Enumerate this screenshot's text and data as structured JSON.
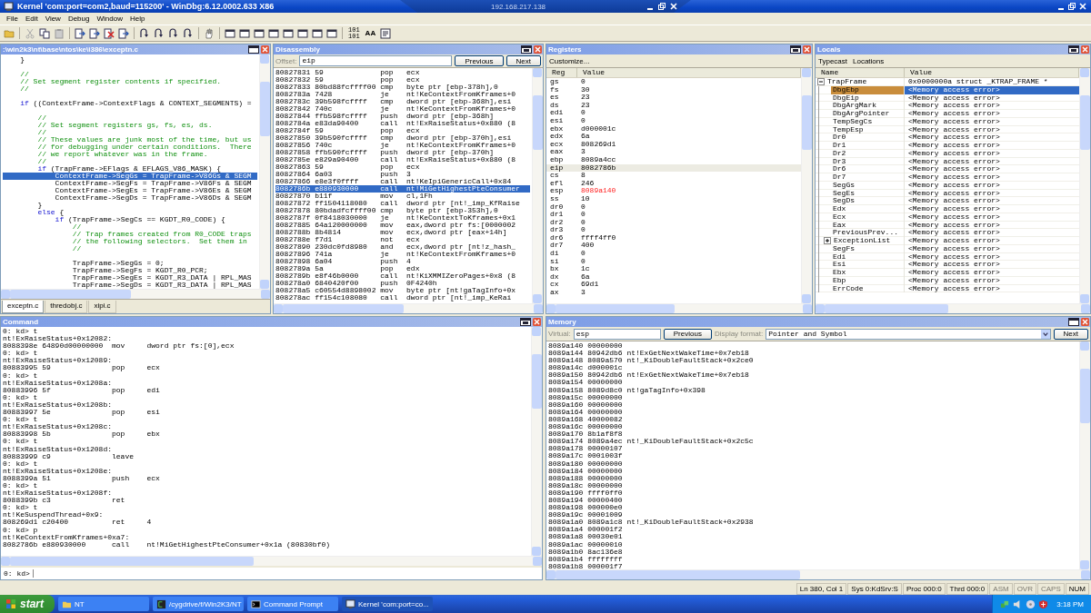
{
  "window": {
    "title": "Kernel 'com:port=com2,baud=115200' - WinDbg:6.12.0002.633 X86"
  },
  "remote_bar": {
    "host": "192.168.217.138"
  },
  "menu": [
    "File",
    "Edit",
    "View",
    "Debug",
    "Window",
    "Help"
  ],
  "toolbar": {
    "binary_labels": [
      "101",
      "101"
    ],
    "font_label": "AA"
  },
  "source": {
    "title": ":\\win2k3\\nt\\base\\ntos\\ke\\i386\\exceptn.c",
    "lines": [
      {
        "kind": "text",
        "selected": false,
        "segs": [
          {
            "kind": "code",
            "text": "    }"
          }
        ]
      },
      {
        "kind": "blank",
        "selected": false
      },
      {
        "kind": "text",
        "selected": false,
        "segs": [
          {
            "kind": "comment",
            "text": "    //"
          }
        ]
      },
      {
        "kind": "text",
        "selected": false,
        "segs": [
          {
            "kind": "comment",
            "text": "    // Set segment register contents if specified."
          }
        ]
      },
      {
        "kind": "text",
        "selected": false,
        "segs": [
          {
            "kind": "comment",
            "text": "    //"
          }
        ]
      },
      {
        "kind": "blank",
        "selected": false
      },
      {
        "kind": "text",
        "selected": false,
        "segs": [
          {
            "kind": "keyword",
            "text": "    if"
          },
          {
            "kind": "code",
            "text": " ((ContextFrame->ContextFlags & CONTEXT_SEGMENTS) ="
          }
        ]
      },
      {
        "kind": "blank",
        "selected": false
      },
      {
        "kind": "text",
        "selected": false,
        "segs": [
          {
            "kind": "comment",
            "text": "        //"
          }
        ]
      },
      {
        "kind": "text",
        "selected": false,
        "segs": [
          {
            "kind": "comment",
            "text": "        // Set segment registers gs, fs, es, ds."
          }
        ]
      },
      {
        "kind": "text",
        "selected": false,
        "segs": [
          {
            "kind": "comment",
            "text": "        //"
          }
        ]
      },
      {
        "kind": "text",
        "selected": false,
        "segs": [
          {
            "kind": "comment",
            "text": "        // These values are junk most of the time, but us"
          }
        ]
      },
      {
        "kind": "text",
        "selected": false,
        "segs": [
          {
            "kind": "comment",
            "text": "        // for debugging under certain conditions.  There"
          }
        ]
      },
      {
        "kind": "text",
        "selected": false,
        "segs": [
          {
            "kind": "comment",
            "text": "        // we report whatever was in the frame."
          }
        ]
      },
      {
        "kind": "text",
        "selected": false,
        "segs": [
          {
            "kind": "comment",
            "text": "        //"
          }
        ]
      },
      {
        "kind": "text",
        "selected": false,
        "segs": [
          {
            "kind": "keyword",
            "text": "        if"
          },
          {
            "kind": "code",
            "text": " (TrapFrame->EFlags & EFLAGS_V86_MASK) {"
          }
        ]
      },
      {
        "kind": "text",
        "selected": true,
        "segs": [
          {
            "kind": "code",
            "text": "            ContextFrame->SegGs = TrapFrame->V86Gs & SEGM"
          }
        ]
      },
      {
        "kind": "text",
        "selected": false,
        "segs": [
          {
            "kind": "code",
            "text": "            ContextFrame->SegFs = TrapFrame->V86Fs & SEGM"
          }
        ]
      },
      {
        "kind": "text",
        "selected": false,
        "segs": [
          {
            "kind": "code",
            "text": "            ContextFrame->SegEs = TrapFrame->V86Es & SEGM"
          }
        ]
      },
      {
        "kind": "text",
        "selected": false,
        "segs": [
          {
            "kind": "code",
            "text": "            ContextFrame->SegDs = TrapFrame->V86Ds & SEGM"
          }
        ]
      },
      {
        "kind": "text",
        "selected": false,
        "segs": [
          {
            "kind": "code",
            "text": "        }"
          }
        ]
      },
      {
        "kind": "text",
        "selected": false,
        "segs": [
          {
            "kind": "keyword",
            "text": "        else"
          },
          {
            "kind": "code",
            "text": " {"
          }
        ]
      },
      {
        "kind": "text",
        "selected": false,
        "segs": [
          {
            "kind": "keyword",
            "text": "            if"
          },
          {
            "kind": "code",
            "text": " (TrapFrame->SegCs == KGDT_R0_CODE) {"
          }
        ]
      },
      {
        "kind": "text",
        "selected": false,
        "segs": [
          {
            "kind": "comment",
            "text": "                //"
          }
        ]
      },
      {
        "kind": "text",
        "selected": false,
        "segs": [
          {
            "kind": "comment",
            "text": "                // Trap frames created from R0_CODE traps"
          }
        ]
      },
      {
        "kind": "text",
        "selected": false,
        "segs": [
          {
            "kind": "comment",
            "text": "                // the following selectors.  Set them in"
          }
        ]
      },
      {
        "kind": "text",
        "selected": false,
        "segs": [
          {
            "kind": "comment",
            "text": "                //"
          }
        ]
      },
      {
        "kind": "blank",
        "selected": false
      },
      {
        "kind": "text",
        "selected": false,
        "segs": [
          {
            "kind": "code",
            "text": "                TrapFrame->SegGs = 0;"
          }
        ]
      },
      {
        "kind": "text",
        "selected": false,
        "segs": [
          {
            "kind": "code",
            "text": "                TrapFrame->SegFs = KGDT_R0_PCR;"
          }
        ]
      },
      {
        "kind": "text",
        "selected": false,
        "segs": [
          {
            "kind": "code",
            "text": "                TrapFrame->SegEs = KGDT_R3_DATA | RPL_MAS"
          }
        ]
      },
      {
        "kind": "text",
        "selected": false,
        "segs": [
          {
            "kind": "code",
            "text": "                TrapFrame->SegDs = KGDT_R3_DATA | RPL_MAS"
          }
        ]
      }
    ],
    "tabs": [
      {
        "label": "exceptn.c",
        "selected": true
      },
      {
        "label": "thredobj.c",
        "selected": false
      },
      {
        "label": "xipi.c",
        "selected": false
      }
    ]
  },
  "disassembly": {
    "title": "Disassembly",
    "offset_label": "Offset:",
    "offset": "eip",
    "previous": "Previous",
    "next": "Next",
    "rows": [
      {
        "address": "80827831",
        "bytes": "59",
        "op": "pop",
        "args": "ecx",
        "selected": false
      },
      {
        "address": "80827832",
        "bytes": "59",
        "op": "pop",
        "args": "ecx",
        "selected": false
      },
      {
        "address": "80827833",
        "bytes": "80bd88fcffff00",
        "op": "cmp",
        "args": "byte ptr [ebp-378h],0",
        "selected": false
      },
      {
        "address": "8082783a",
        "bytes": "7428",
        "op": "je",
        "args": "nt!KeContextFromKframes+0",
        "selected": false
      },
      {
        "address": "8082783c",
        "bytes": "39b598fcffff",
        "op": "cmp",
        "args": "dword ptr [ebp-368h],esi",
        "selected": false
      },
      {
        "address": "80827842",
        "bytes": "740c",
        "op": "je",
        "args": "nt!KeContextFromKframes+0",
        "selected": false
      },
      {
        "address": "80827844",
        "bytes": "ffb598fcffff",
        "op": "push",
        "args": "dword ptr [ebp-368h]",
        "selected": false
      },
      {
        "address": "8082784a",
        "bytes": "e83da90400",
        "op": "call",
        "args": "nt!ExRaiseStatus+0x880 (8",
        "selected": false
      },
      {
        "address": "8082784f",
        "bytes": "59",
        "op": "pop",
        "args": "ecx",
        "selected": false
      },
      {
        "address": "80827850",
        "bytes": "39b590fcffff",
        "op": "cmp",
        "args": "dword ptr [ebp-370h],esi",
        "selected": false
      },
      {
        "address": "80827856",
        "bytes": "740c",
        "op": "je",
        "args": "nt!KeContextFromKframes+0",
        "selected": false
      },
      {
        "address": "80827858",
        "bytes": "ffb590fcffff",
        "op": "push",
        "args": "dword ptr [ebp-370h]",
        "selected": false
      },
      {
        "address": "8082785e",
        "bytes": "e829a90400",
        "op": "call",
        "args": "nt!ExRaiseStatus+0x880 (8",
        "selected": false
      },
      {
        "address": "80827863",
        "bytes": "59",
        "op": "pop",
        "args": "ecx",
        "selected": false
      },
      {
        "address": "80827864",
        "bytes": "6a03",
        "op": "push",
        "args": "3",
        "selected": false
      },
      {
        "address": "80827866",
        "bytes": "e8e3f0ffff",
        "op": "call",
        "args": "nt!KeIpiGenericCall+0x84",
        "selected": false
      },
      {
        "address": "8082786b",
        "bytes": "e880930000",
        "op": "call",
        "args": "nt!MiGetHighestPteConsumer",
        "selected": true
      },
      {
        "address": "80827870",
        "bytes": "b11f",
        "op": "mov",
        "args": "cl,1Fh",
        "selected": false
      },
      {
        "address": "80827872",
        "bytes": "ff1504118080",
        "op": "call",
        "args": "dword ptr [nt!_imp_KfRaise",
        "selected": false
      },
      {
        "address": "80827878",
        "bytes": "80bdadfcffff00",
        "op": "cmp",
        "args": "byte ptr [ebp-353h],0",
        "selected": false
      },
      {
        "address": "8082787f",
        "bytes": "0f8418030000",
        "op": "je",
        "args": "nt!KeContextToKframes+0x1",
        "selected": false
      },
      {
        "address": "80827885",
        "bytes": "64a120000000",
        "op": "mov",
        "args": "eax,dword ptr fs:[0000002",
        "selected": false
      },
      {
        "address": "8082788b",
        "bytes": "8b4814",
        "op": "mov",
        "args": "ecx,dword ptr [eax+14h]",
        "selected": false
      },
      {
        "address": "8082788e",
        "bytes": "f7d1",
        "op": "not",
        "args": "ecx",
        "selected": false
      },
      {
        "address": "80827890",
        "bytes": "230dc0fd8980",
        "op": "and",
        "args": "ecx,dword ptr [nt!z_hash_",
        "selected": false
      },
      {
        "address": "80827896",
        "bytes": "741a",
        "op": "je",
        "args": "nt!KeContextFromKframes+0",
        "selected": false
      },
      {
        "address": "80827898",
        "bytes": "6a04",
        "op": "push",
        "args": "4",
        "selected": false
      },
      {
        "address": "8082789a",
        "bytes": "5a",
        "op": "pop",
        "args": "edx",
        "selected": false
      },
      {
        "address": "8082789b",
        "bytes": "e8f46b0000",
        "op": "call",
        "args": "nt!KiXMMIZeroPages+0x8 (8",
        "selected": false
      },
      {
        "address": "808278a0",
        "bytes": "6840420f00",
        "op": "push",
        "args": "0F4240h",
        "selected": false
      },
      {
        "address": "808278a5",
        "bytes": "c60554d8898002",
        "op": "mov",
        "args": "byte ptr [nt!gaTagInfo+0x",
        "selected": false
      },
      {
        "address": "808278ac",
        "bytes": "ff154c108080",
        "op": "call",
        "args": "dword ptr [nt!_imp_KeRai",
        "selected": false
      }
    ]
  },
  "registers": {
    "title": "Registers",
    "customize": "Customize...",
    "columns": [
      "Reg",
      "Value"
    ],
    "rows": [
      {
        "name": "gs",
        "value": "0",
        "selected": false,
        "changed": false
      },
      {
        "name": "fs",
        "value": "30",
        "selected": false,
        "changed": false
      },
      {
        "name": "es",
        "value": "23",
        "selected": false,
        "changed": false
      },
      {
        "name": "ds",
        "value": "23",
        "selected": false,
        "changed": false
      },
      {
        "name": "edi",
        "value": "0",
        "selected": false,
        "changed": false
      },
      {
        "name": "esi",
        "value": "0",
        "selected": false,
        "changed": false
      },
      {
        "name": "ebx",
        "value": "d000001c",
        "selected": false,
        "changed": false
      },
      {
        "name": "edx",
        "value": "6a",
        "selected": false,
        "changed": false
      },
      {
        "name": "ecx",
        "value": "808269d1",
        "selected": false,
        "changed": false
      },
      {
        "name": "eax",
        "value": "3",
        "selected": false,
        "changed": false
      },
      {
        "name": "ebp",
        "value": "8089a4cc",
        "selected": false,
        "changed": false
      },
      {
        "name": "eip",
        "value": "8082786b",
        "selected": true,
        "changed": false
      },
      {
        "name": "cs",
        "value": "8",
        "selected": false,
        "changed": false
      },
      {
        "name": "efl",
        "value": "246",
        "selected": false,
        "changed": false
      },
      {
        "name": "esp",
        "value": "8089a140",
        "selected": false,
        "changed": true
      },
      {
        "name": "ss",
        "value": "10",
        "selected": false,
        "changed": false
      },
      {
        "name": "dr0",
        "value": "0",
        "selected": false,
        "changed": false
      },
      {
        "name": "dr1",
        "value": "0",
        "selected": false,
        "changed": false
      },
      {
        "name": "dr2",
        "value": "0",
        "selected": false,
        "changed": false
      },
      {
        "name": "dr3",
        "value": "0",
        "selected": false,
        "changed": false
      },
      {
        "name": "dr6",
        "value": "ffff4ff0",
        "selected": false,
        "changed": false
      },
      {
        "name": "dr7",
        "value": "400",
        "selected": false,
        "changed": false
      },
      {
        "name": "di",
        "value": "0",
        "selected": false,
        "changed": false
      },
      {
        "name": "si",
        "value": "0",
        "selected": false,
        "changed": false
      },
      {
        "name": "bx",
        "value": "1c",
        "selected": false,
        "changed": false
      },
      {
        "name": "dx",
        "value": "6a",
        "selected": false,
        "changed": false
      },
      {
        "name": "cx",
        "value": "69d1",
        "selected": false,
        "changed": false
      },
      {
        "name": "ax",
        "value": "3",
        "selected": false,
        "changed": false
      }
    ]
  },
  "locals": {
    "title": "Locals",
    "menu": [
      "Typecast",
      "Locations"
    ],
    "columns": [
      "Name",
      "Value"
    ],
    "root": {
      "name": "TrapFrame",
      "value": "0x0000000a struct _KTRAP_FRAME *",
      "expanded": true,
      "children": [
        {
          "name": "DbgEbp",
          "value": "<Memory access error>",
          "kind": "field",
          "selected": true
        },
        {
          "name": "DbgEip",
          "value": "<Memory access error>",
          "kind": "field",
          "selected": false
        },
        {
          "name": "DbgArgMark",
          "value": "<Memory access error>",
          "kind": "field",
          "selected": false
        },
        {
          "name": "DbgArgPointer",
          "value": "<Memory access error>",
          "kind": "field",
          "selected": false
        },
        {
          "name": "TempSegCs",
          "value": "<Memory access error>",
          "kind": "field",
          "selected": false
        },
        {
          "name": "TempEsp",
          "value": "<Memory access error>",
          "kind": "field",
          "selected": false
        },
        {
          "name": "Dr0",
          "value": "<Memory access error>",
          "kind": "field",
          "selected": false
        },
        {
          "name": "Dr1",
          "value": "<Memory access error>",
          "kind": "field",
          "selected": false
        },
        {
          "name": "Dr2",
          "value": "<Memory access error>",
          "kind": "field",
          "selected": false
        },
        {
          "name": "Dr3",
          "value": "<Memory access error>",
          "kind": "field",
          "selected": false
        },
        {
          "name": "Dr6",
          "value": "<Memory access error>",
          "kind": "field",
          "selected": false
        },
        {
          "name": "Dr7",
          "value": "<Memory access error>",
          "kind": "field",
          "selected": false
        },
        {
          "name": "SegGs",
          "value": "<Memory access error>",
          "kind": "field",
          "selected": false
        },
        {
          "name": "SegEs",
          "value": "<Memory access error>",
          "kind": "field",
          "selected": false
        },
        {
          "name": "SegDs",
          "value": "<Memory access error>",
          "kind": "field",
          "selected": false
        },
        {
          "name": "Edx",
          "value": "<Memory access error>",
          "kind": "field",
          "selected": false
        },
        {
          "name": "Ecx",
          "value": "<Memory access error>",
          "kind": "field",
          "selected": false
        },
        {
          "name": "Eax",
          "value": "<Memory access error>",
          "kind": "field",
          "selected": false
        },
        {
          "name": "PreviousPrev...",
          "value": "<Memory access error>",
          "kind": "field",
          "selected": false
        },
        {
          "name": "ExceptionList",
          "value": "<Memory access error>",
          "kind": "struct",
          "expanded": false,
          "selected": false
        },
        {
          "name": "SegFs",
          "value": "<Memory access error>",
          "kind": "field",
          "selected": false
        },
        {
          "name": "Edi",
          "value": "<Memory access error>",
          "kind": "field",
          "selected": false
        },
        {
          "name": "Esi",
          "value": "<Memory access error>",
          "kind": "field",
          "selected": false
        },
        {
          "name": "Ebx",
          "value": "<Memory access error>",
          "kind": "field",
          "selected": false
        },
        {
          "name": "Ebp",
          "value": "<Memory access error>",
          "kind": "field",
          "selected": false
        },
        {
          "name": "ErrCode",
          "value": "<Memory access error>",
          "kind": "field",
          "selected": false
        }
      ]
    }
  },
  "command": {
    "title": "Command",
    "prompt": "0: kd>",
    "lines": [
      "0: kd> t",
      "nt!ExRaiseStatus+0x12082:",
      "8088398e 64890d00000000  mov     dword ptr fs:[0],ecx",
      "0: kd> t",
      "nt!ExRaiseStatus+0x12089:",
      "80883995 59              pop     ecx",
      "0: kd> t",
      "nt!ExRaiseStatus+0x1208a:",
      "80883996 5f              pop     edi",
      "0: kd> t",
      "nt!ExRaiseStatus+0x1208b:",
      "80883997 5e              pop     esi",
      "0: kd> t",
      "nt!ExRaiseStatus+0x1208c:",
      "80883998 5b              pop     ebx",
      "0: kd> t",
      "nt!ExRaiseStatus+0x1208d:",
      "80883999 c9              leave",
      "0: kd> t",
      "nt!ExRaiseStatus+0x1208e:",
      "8088399a 51              push    ecx",
      "0: kd> t",
      "nt!ExRaiseStatus+0x1208f:",
      "8088399b c3              ret",
      "0: kd> t",
      "nt!KeSuspendThread+0x9:",
      "808269d1 c20400          ret     4",
      "0: kd> p",
      "nt!KeContextFromKframes+0xa7:",
      "8082786b e880930000      call    nt!MiGetHighestPteConsumer+0x1a (80830bf0)"
    ]
  },
  "memory": {
    "title": "Memory",
    "virtual_label": "Virtual:",
    "virtual": "esp",
    "previous": "Previous",
    "format_label": "Display format:",
    "format": "Pointer and Symbol",
    "next": "Next",
    "rows": [
      {
        "address": "8089a140",
        "value": "00000000"
      },
      {
        "address": "8089a144",
        "value": "80942db6",
        "symbol": "nt!ExGetNextWakeTime+0x7eb18"
      },
      {
        "address": "8089a148",
        "value": "8089a570",
        "symbol": "nt!_KiDoubleFaultStack+0x2ce0"
      },
      {
        "address": "8089a14c",
        "value": "d000001c"
      },
      {
        "address": "8089a150",
        "value": "80942db6",
        "symbol": "nt!ExGetNextWakeTime+0x7eb18"
      },
      {
        "address": "8089a154",
        "value": "00000000"
      },
      {
        "address": "8089a158",
        "value": "8089d8c0",
        "symbol": "nt!gaTagInfo+0x398"
      },
      {
        "address": "8089a15c",
        "value": "00000000"
      },
      {
        "address": "8089a160",
        "value": "00000000"
      },
      {
        "address": "8089a164",
        "value": "00000000"
      },
      {
        "address": "8089a168",
        "value": "40000082"
      },
      {
        "address": "8089a16c",
        "value": "00000000"
      },
      {
        "address": "8089a170",
        "value": "8b1af8f8"
      },
      {
        "address": "8089a174",
        "value": "8089a4ec",
        "symbol": "nt!_KiDoubleFaultStack+0x2c5c"
      },
      {
        "address": "8089a178",
        "value": "00000107"
      },
      {
        "address": "8089a17c",
        "value": "0001003f"
      },
      {
        "address": "8089a180",
        "value": "00000000"
      },
      {
        "address": "8089a184",
        "value": "00000000"
      },
      {
        "address": "8089a188",
        "value": "00000000"
      },
      {
        "address": "8089a18c",
        "value": "00000000"
      },
      {
        "address": "8089a190",
        "value": "ffff0ff0"
      },
      {
        "address": "8089a194",
        "value": "00000400"
      },
      {
        "address": "8089a198",
        "value": "000000e0"
      },
      {
        "address": "8089a19c",
        "value": "00001009"
      },
      {
        "address": "8089a1a0",
        "value": "8089a1c8",
        "symbol": "nt!_KiDoubleFaultStack+0x2938"
      },
      {
        "address": "8089a1a4",
        "value": "000001f2"
      },
      {
        "address": "8089a1a8",
        "value": "00030e01"
      },
      {
        "address": "8089a1ac",
        "value": "00000010"
      },
      {
        "address": "8089a1b0",
        "value": "8ac136e8"
      },
      {
        "address": "8089a1b4",
        "value": "ffffffff"
      },
      {
        "address": "8089a1b8",
        "value": "000001f7"
      }
    ]
  },
  "status_bar": [
    {
      "text": "Ln 380, Col 1",
      "disabled": false
    },
    {
      "text": "Sys 0:KdSrv:S",
      "disabled": false
    },
    {
      "text": "Proc 000:0",
      "disabled": false
    },
    {
      "text": "Thrd 000:0",
      "disabled": false
    },
    {
      "text": "ASM",
      "disabled": true
    },
    {
      "text": "OVR",
      "disabled": true
    },
    {
      "text": "CAPS",
      "disabled": true
    },
    {
      "text": "NUM",
      "disabled": false
    }
  ],
  "taskbar": {
    "start": "start",
    "items": [
      {
        "label": "NT",
        "kind": "folder",
        "selected": false
      },
      {
        "label": "/cygdrive/f/Win2K3/NT",
        "kind": "terminal",
        "selected": false
      },
      {
        "label": "Command Prompt",
        "kind": "console",
        "selected": false
      },
      {
        "label": "Kernel 'com:port=co...",
        "kind": "debugger",
        "selected": true
      }
    ],
    "clock": "3:18 PM"
  }
}
